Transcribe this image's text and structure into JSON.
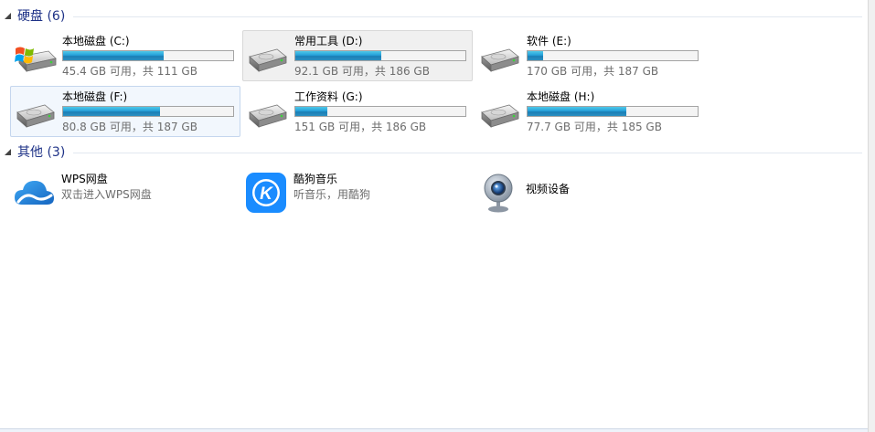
{
  "groups": {
    "drives_title": "硬盘 (6)",
    "other_title": "其他 (3)"
  },
  "drives": [
    {
      "name": "本地磁盘 (C:)",
      "free_text": "45.4 GB 可用，共 111 GB",
      "free_gb": 45.4,
      "total_gb": 111,
      "icon": "windows-drive-icon"
    },
    {
      "name": "常用工具 (D:)",
      "free_text": "92.1 GB 可用，共 186 GB",
      "free_gb": 92.1,
      "total_gb": 186,
      "icon": "hard-drive-icon"
    },
    {
      "name": "软件 (E:)",
      "free_text": "170 GB 可用，共 187 GB",
      "free_gb": 170,
      "total_gb": 187,
      "icon": "hard-drive-icon"
    },
    {
      "name": "本地磁盘 (F:)",
      "free_text": "80.8 GB 可用，共 187 GB",
      "free_gb": 80.8,
      "total_gb": 187,
      "icon": "hard-drive-icon"
    },
    {
      "name": "工作资料 (G:)",
      "free_text": "151 GB 可用，共 186 GB",
      "free_gb": 151,
      "total_gb": 186,
      "icon": "hard-drive-icon"
    },
    {
      "name": "本地磁盘 (H:)",
      "free_text": "77.7 GB 可用，共 185 GB",
      "free_gb": 77.7,
      "total_gb": 185,
      "icon": "hard-drive-icon"
    }
  ],
  "others": [
    {
      "name": "WPS网盘",
      "sub": "双击进入WPS网盘",
      "icon": "cloud-icon"
    },
    {
      "name": "酷狗音乐",
      "sub": "听音乐，用酷狗",
      "icon": "kugou-icon"
    },
    {
      "name": "视频设备",
      "sub": "",
      "icon": "webcam-icon"
    }
  ],
  "colors": {
    "group_title": "#1e3287",
    "bar_fill": "#26a0da",
    "kugou_blue": "#1a8cff",
    "cloud_blue": "#1e88e5"
  }
}
